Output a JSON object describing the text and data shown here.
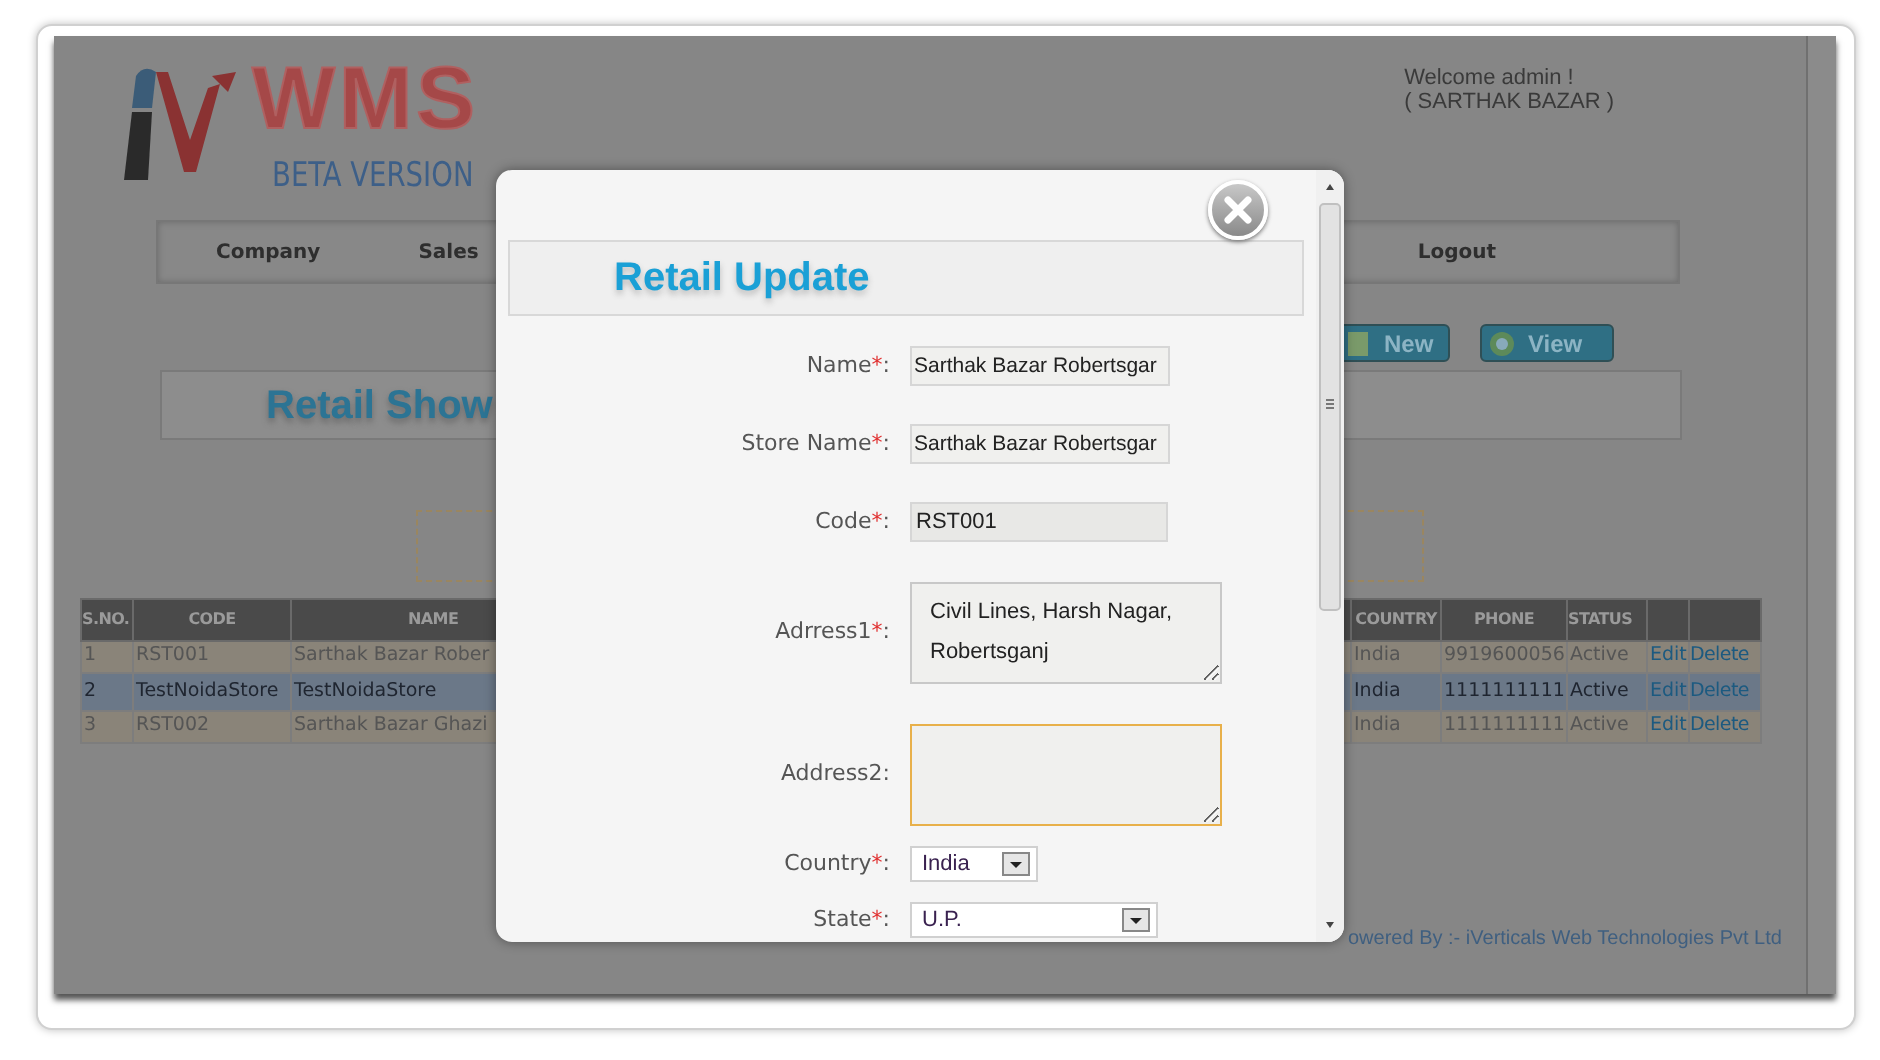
{
  "header": {
    "logo_text": "WMS",
    "logo_subtitle": "BETA VERSION",
    "welcome": "Welcome admin !",
    "company": "( SARTHAK BAZAR )"
  },
  "nav": [
    {
      "label": "Company"
    },
    {
      "label": "Sales"
    },
    {
      "label": "Logout"
    }
  ],
  "actions": [
    {
      "label": "New",
      "kind": "new"
    },
    {
      "label": "View",
      "kind": "view"
    }
  ],
  "page_title": "Retail Show",
  "table": {
    "columns": [
      "S.NO.",
      "CODE",
      "NAME",
      "COUNTRY",
      "PHONE",
      "STATUS"
    ],
    "rows": [
      {
        "sno": "1",
        "code": "RST001",
        "name": "Sarthak Bazar Rober",
        "country": "India",
        "phone": "9919600056",
        "status": "Active",
        "edit": "Edit",
        "delete": "Delete",
        "selected": false
      },
      {
        "sno": "2",
        "code": "TestNoidaStore",
        "name": "TestNoidaStore",
        "country": "India",
        "phone": "1111111111",
        "status": "Active",
        "edit": "Edit",
        "delete": "Delete",
        "selected": true
      },
      {
        "sno": "3",
        "code": "RST002",
        "name": "Sarthak Bazar Ghazi",
        "country": "India",
        "phone": "1111111111",
        "status": "Active",
        "edit": "Edit",
        "delete": "Delete",
        "selected": false
      }
    ]
  },
  "footer": "owered By :- iVerticals Web Technologies Pvt Ltd",
  "modal": {
    "title": "Retail Update",
    "fields": [
      {
        "kind": "text",
        "label": "Name",
        "required_mark": "*",
        "suffix": ":",
        "value": "Sarthak Bazar Robertsgar"
      },
      {
        "kind": "text",
        "label": "Store Name",
        "required_mark": "*",
        "suffix": ":",
        "value": "Sarthak Bazar Robertsgar"
      },
      {
        "kind": "readonly",
        "label": "Code",
        "required_mark": "*",
        "suffix": ":",
        "value": "RST001"
      },
      {
        "kind": "textarea",
        "label": "Adrress1",
        "required_mark": "*",
        "suffix": ":",
        "value": "Civil Lines, Harsh Nagar, Robertsganj",
        "focused": false
      },
      {
        "kind": "textarea",
        "label": "Address2",
        "suffix": ":",
        "focused": true
      },
      {
        "kind": "select",
        "label": "Country",
        "required_mark": "*",
        "suffix": ":",
        "value": "India"
      },
      {
        "kind": "select",
        "label": "State",
        "required_mark": "*",
        "suffix": ":",
        "value": "U.P."
      }
    ]
  }
}
